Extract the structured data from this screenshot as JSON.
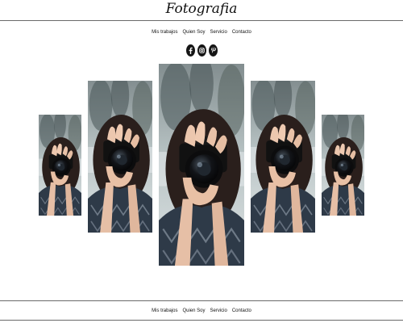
{
  "site": {
    "title": "Fotografia"
  },
  "nav_top": [
    {
      "label": "Mis trabajos"
    },
    {
      "label": "Quien Soy"
    },
    {
      "label": "Servicio"
    },
    {
      "label": "Contacto"
    }
  ],
  "social": [
    {
      "icon": "facebook-icon"
    },
    {
      "icon": "instagram-icon"
    },
    {
      "icon": "pinterest-icon"
    }
  ],
  "gallery": {
    "panels": [
      {
        "subject": "woman-holding-camera"
      },
      {
        "subject": "woman-holding-camera"
      },
      {
        "subject": "woman-holding-camera"
      },
      {
        "subject": "woman-holding-camera"
      },
      {
        "subject": "woman-holding-camera"
      }
    ]
  },
  "nav_bottom": [
    {
      "label": "Mis trabajos"
    },
    {
      "label": "Quien Soy"
    },
    {
      "label": "Servicio"
    },
    {
      "label": "Contacto"
    }
  ],
  "colors": {
    "background": "#ffffff",
    "text": "#111111",
    "rule": "#6a6a6a",
    "icon_bg": "#151515"
  }
}
